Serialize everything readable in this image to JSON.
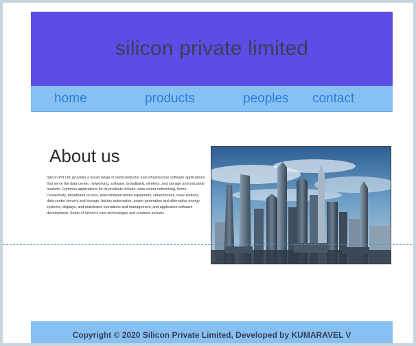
{
  "header": {
    "title": "silicon private limited"
  },
  "nav": {
    "items": [
      {
        "label": "home"
      },
      {
        "label": "products"
      },
      {
        "label": "peoples"
      },
      {
        "label": "contact"
      }
    ]
  },
  "about": {
    "title": "About us",
    "text": "Silicon Pvt Ltd, provides a broad range of semiconductor and infrastructure software applications that serve the data center, networking, software, broadband, wireless, and storage and industrial markets. Common applications for its products include: data center networking, home connectivity, broadband access, telecommunications equipment, smartphones, base stations, data center servers and storage, factory automation, power generation and alternative energy systems, displays, and mainframe operations and management, and application software development. Some of Silicon's core technologies and products include:"
  },
  "image": {
    "description_icon": "city-skyline-image"
  },
  "footer": {
    "copyright": "Copyright © 2020 Silicon Private Limited, Developed by KUMARAVEL V"
  },
  "colors": {
    "header_bg": "#5b4de6",
    "nav_bg": "#87c0f2",
    "nav_link": "#2b7fd8",
    "footer_bg": "#87c0f2"
  }
}
